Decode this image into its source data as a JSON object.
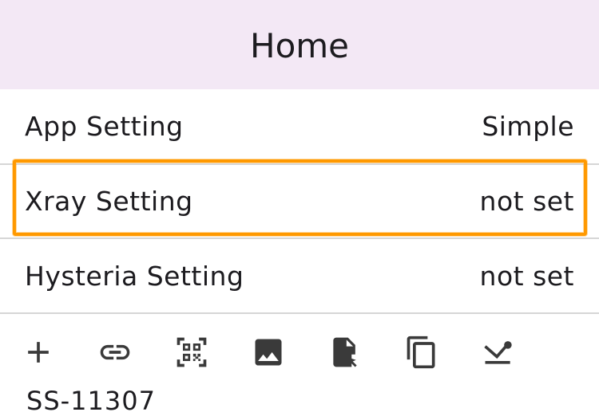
{
  "appbar": {
    "title": "Home"
  },
  "settings": [
    {
      "label": "App Setting",
      "value": "Simple"
    },
    {
      "label": "Xray Setting",
      "value": "not set"
    },
    {
      "label": "Hysteria Setting",
      "value": "not set"
    }
  ],
  "highlight_color": "#ff9900",
  "toolbar": {
    "icons": [
      "add-icon",
      "link-icon",
      "qr-code-scan-icon",
      "image-icon",
      "file-select-icon",
      "copy-icon",
      "download-icon"
    ]
  },
  "footer": {
    "cut_text": "SS-11307"
  }
}
